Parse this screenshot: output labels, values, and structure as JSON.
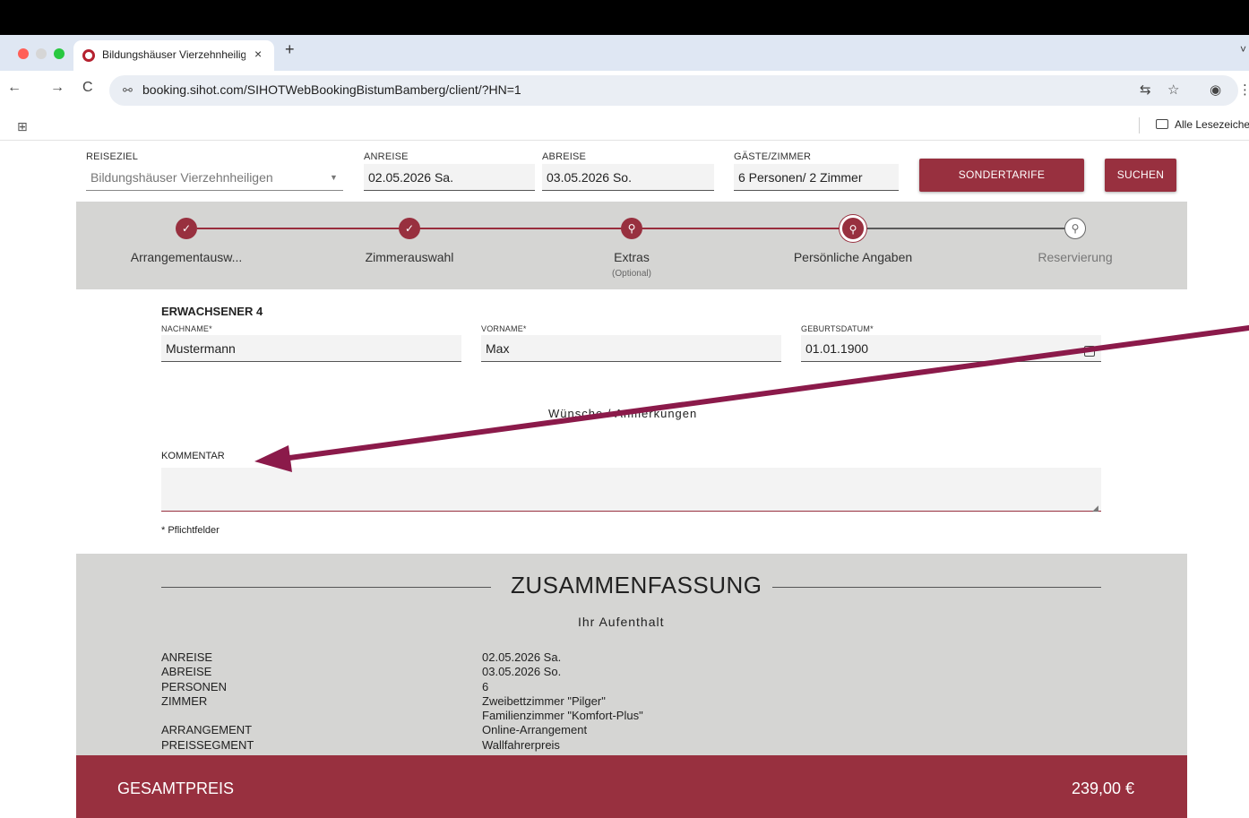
{
  "browser": {
    "tab_title": "Bildungshäuser Vierzehnheilig",
    "tab_close": "×",
    "new_tab": "+",
    "back": "←",
    "forward": "→",
    "reload": "C",
    "site_info": "⚯",
    "url": "booking.sihot.com/SIHOTWebBookingBistumBamberg/client/?HN=1",
    "translate": "⇆",
    "star": "☆",
    "profile": "◉",
    "menu": "⋮",
    "tab_menu": "˅",
    "apps": "⊞",
    "bookmarks_label": "Alle Lesezeiche"
  },
  "search": {
    "destination_label": "REISEZIEL",
    "destination_value": "Bildungshäuser Vierzehnheiligen",
    "destination_caret": "▼",
    "arrival_label": "ANREISE",
    "arrival_value": "02.05.2026 Sa.",
    "departure_label": "ABREISE",
    "departure_value": "03.05.2026 So.",
    "guests_label": "GÄSTE/ZIMMER",
    "guests_value": "6 Personen/ 2 Zimmer",
    "special_rates_button": "SONDERTARIFE",
    "search_button": "SUCHEN"
  },
  "stepper": {
    "steps": [
      {
        "label": "Arrangementausw...",
        "icon": "✓",
        "state": "done"
      },
      {
        "label": "Zimmerauswahl",
        "icon": "✓",
        "state": "done"
      },
      {
        "label": "Extras",
        "sub": "(Optional)",
        "icon": "⚲",
        "state": "done"
      },
      {
        "label": "Persönliche Angaben",
        "icon": "⚲",
        "state": "current"
      },
      {
        "label": "Reservierung",
        "icon": "⚲",
        "state": "pending"
      }
    ]
  },
  "guest": {
    "heading": "ERWACHSENER 4",
    "lastname_label": "NACHNAME*",
    "lastname_value": "Mustermann",
    "firstname_label": "VORNAME*",
    "firstname_value": "Max",
    "birthdate_label": "GEBURTSDATUM*",
    "birthdate_value": "01.01.1900"
  },
  "wishes": {
    "heading": "Wünsche / Anmerkungen",
    "comment_label": "KOMMENTAR",
    "comment_value": "",
    "resize_grip": "◢",
    "required_note": "* Pflichtfelder"
  },
  "summary": {
    "title": "ZUSAMMENFASSUNG",
    "subtitle": "Ihr Aufenthalt",
    "rows": [
      {
        "label": "ANREISE",
        "value": "02.05.2026 Sa."
      },
      {
        "label": "ABREISE",
        "value": "03.05.2026 So."
      },
      {
        "label": "PERSONEN",
        "value": "6"
      },
      {
        "label": "ZIMMER",
        "value": "Zweibettzimmer \"Pilger\""
      },
      {
        "label": "",
        "value": "Familienzimmer \"Komfort-Plus\""
      },
      {
        "label": "ARRANGEMENT",
        "value": "Online-Arrangement"
      },
      {
        "label": "PREISSEGMENT",
        "value": "Wallfahrerpreis"
      }
    ],
    "total_label": "GESAMTPREIS",
    "total_value": "239,00 €"
  },
  "colors": {
    "brand": "#98303f",
    "panel": "#d5d5d3",
    "annotation_arrow": "#8b1a4a"
  }
}
